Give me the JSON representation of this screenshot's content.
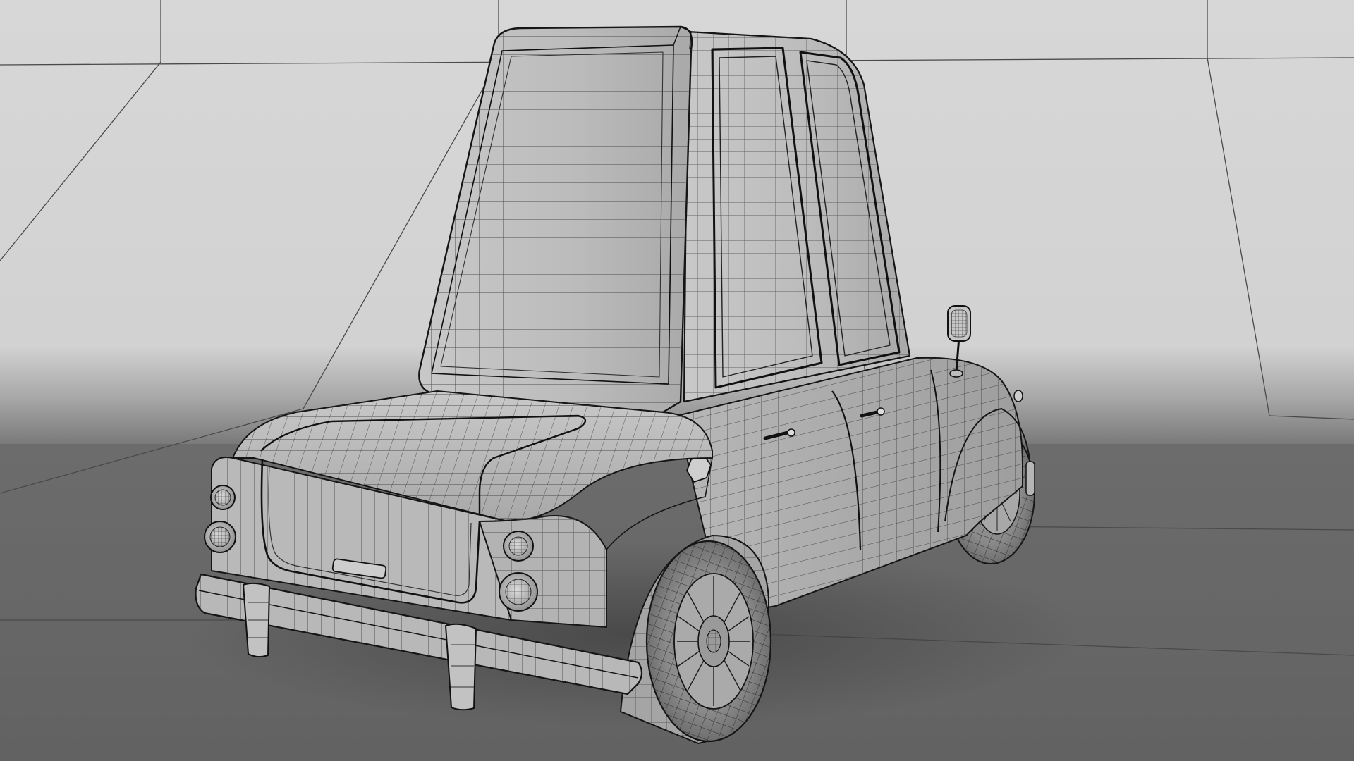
{
  "scene": {
    "subject": "car-wireframe-render",
    "colors": {
      "wall": "#d9d9d9",
      "floor": "#707070",
      "body": "#bdbdbd",
      "edge": "#151515",
      "wire": "#2e2e2e"
    }
  }
}
